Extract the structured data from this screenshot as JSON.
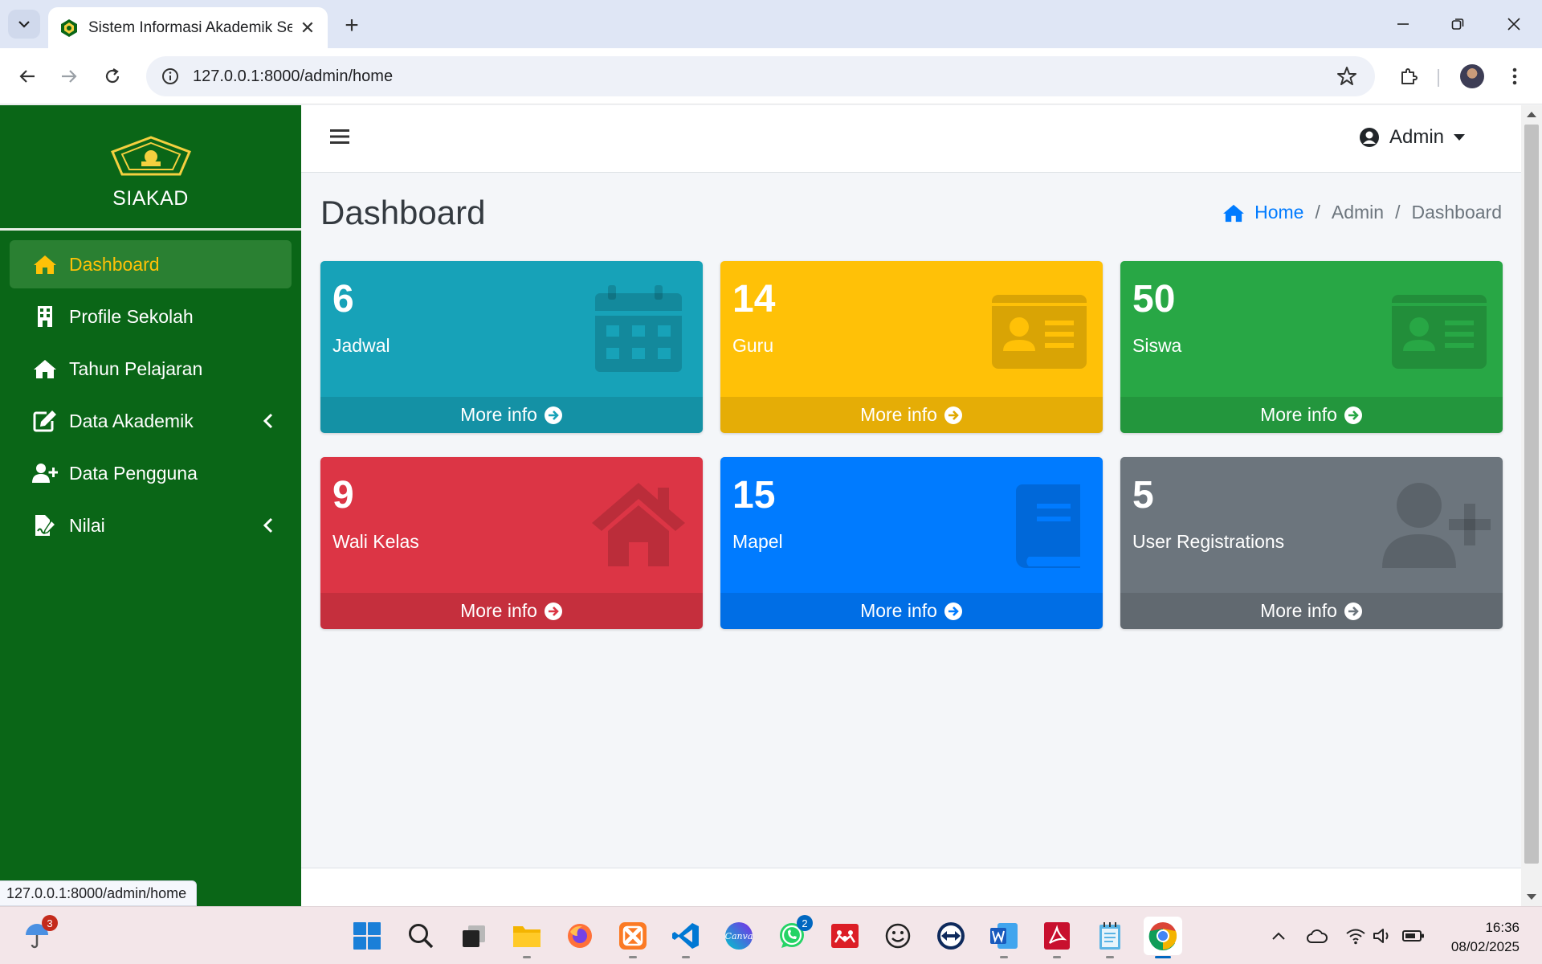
{
  "browser": {
    "tab_title": "Sistem Informasi Akademik Sek",
    "new_tab_symbol": "+",
    "close_symbol": "✕",
    "url": "127.0.0.1:8000/admin/home",
    "status_url": "127.0.0.1:8000/admin/home"
  },
  "sidebar": {
    "brand": "SIAKAD",
    "items": [
      {
        "label": "Dashboard",
        "icon": "home-icon",
        "active": true
      },
      {
        "label": "Profile Sekolah",
        "icon": "building-icon"
      },
      {
        "label": "Tahun Pelajaran",
        "icon": "home-icon"
      },
      {
        "label": "Data Akademik",
        "icon": "edit-icon",
        "has_submenu": true
      },
      {
        "label": "Data Pengguna",
        "icon": "user-plus-icon"
      },
      {
        "label": "Nilai",
        "icon": "file-signature-icon",
        "has_submenu": true
      }
    ]
  },
  "topnav": {
    "user": "Admin"
  },
  "page": {
    "title": "Dashboard",
    "breadcrumb": [
      "Home",
      "Admin",
      "Dashboard"
    ],
    "breadcrumb_sep": "/"
  },
  "boxes": [
    {
      "value": "6",
      "label": "Jadwal",
      "footer": "More info",
      "color": "#17a2b8",
      "icon": "calendar-icon"
    },
    {
      "value": "14",
      "label": "Guru",
      "footer": "More info",
      "color": "#ffc107",
      "icon": "id-card-icon"
    },
    {
      "value": "50",
      "label": "Siswa",
      "footer": "More info",
      "color": "#28a745",
      "icon": "id-card-icon"
    },
    {
      "value": "9",
      "label": "Wali Kelas",
      "footer": "More info",
      "color": "#dc3545",
      "icon": "house-icon"
    },
    {
      "value": "15",
      "label": "Mapel",
      "footer": "More info",
      "color": "#007bff",
      "icon": "book-icon"
    },
    {
      "value": "5",
      "label": "User Registrations",
      "footer": "More info",
      "color": "#6c757d",
      "icon": "user-plus-icon"
    }
  ],
  "taskbar": {
    "weather_badge": "3",
    "whatsapp_badge": "2",
    "time": "16:36",
    "date": "08/02/2025"
  }
}
